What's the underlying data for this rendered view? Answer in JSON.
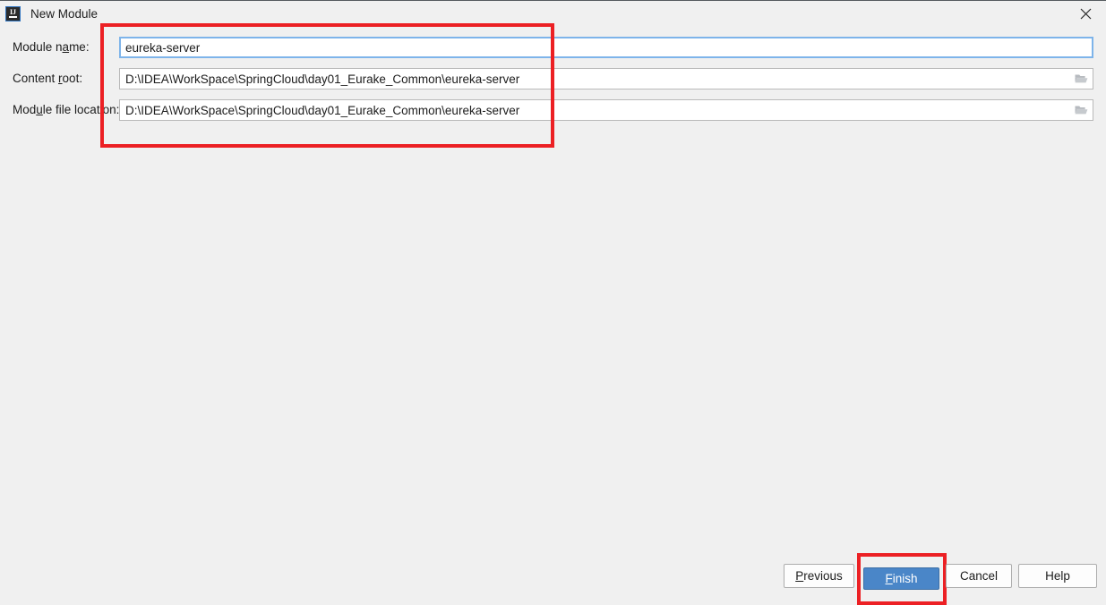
{
  "window": {
    "title": "New Module",
    "icon": "intellij-idea-icon",
    "close_label": "×",
    "background_color": "#f0f0f0"
  },
  "form": {
    "rows": [
      {
        "label_pre": "Module n",
        "label_mnemonic": "a",
        "label_post": "me:",
        "label_full": "Module name:",
        "field_name": "module-name-input",
        "value": "eureka-server",
        "placeholder": "",
        "focused": true,
        "has_browse": false
      },
      {
        "label_pre": "Content ",
        "label_mnemonic": "r",
        "label_post": "oot:",
        "label_full": "Content root:",
        "field_name": "content-root-input",
        "value": "D:\\IDEA\\WorkSpace\\SpringCloud\\day01_Eurake_Common\\eureka-server",
        "placeholder": "",
        "focused": false,
        "has_browse": true,
        "browse_icon": "folder-icon"
      },
      {
        "label_pre": "Mod",
        "label_mnemonic": "u",
        "label_post": "le file location:",
        "label_full": "Module file location:",
        "field_name": "module-file-location-input",
        "value": "D:\\IDEA\\WorkSpace\\SpringCloud\\day01_Eurake_Common\\eureka-server",
        "placeholder": "",
        "focused": false,
        "has_browse": true,
        "browse_icon": "folder-icon"
      }
    ]
  },
  "buttons": {
    "previous": {
      "pre": "",
      "mnemonic": "P",
      "post": "revious",
      "full": "Previous"
    },
    "finish": {
      "pre": "",
      "mnemonic": "F",
      "post": "inish",
      "full": "Finish"
    },
    "cancel": {
      "pre": "Cancel",
      "mnemonic": "",
      "post": "",
      "full": "Cancel"
    },
    "help": {
      "pre": "Help",
      "mnemonic": "",
      "post": "",
      "full": "Help"
    }
  },
  "annotations": {
    "color": "#ec2024",
    "boxes": [
      {
        "name": "fields-highlight",
        "target": "module-fields-group"
      },
      {
        "name": "finish-highlight",
        "target": "finish-button"
      }
    ]
  }
}
